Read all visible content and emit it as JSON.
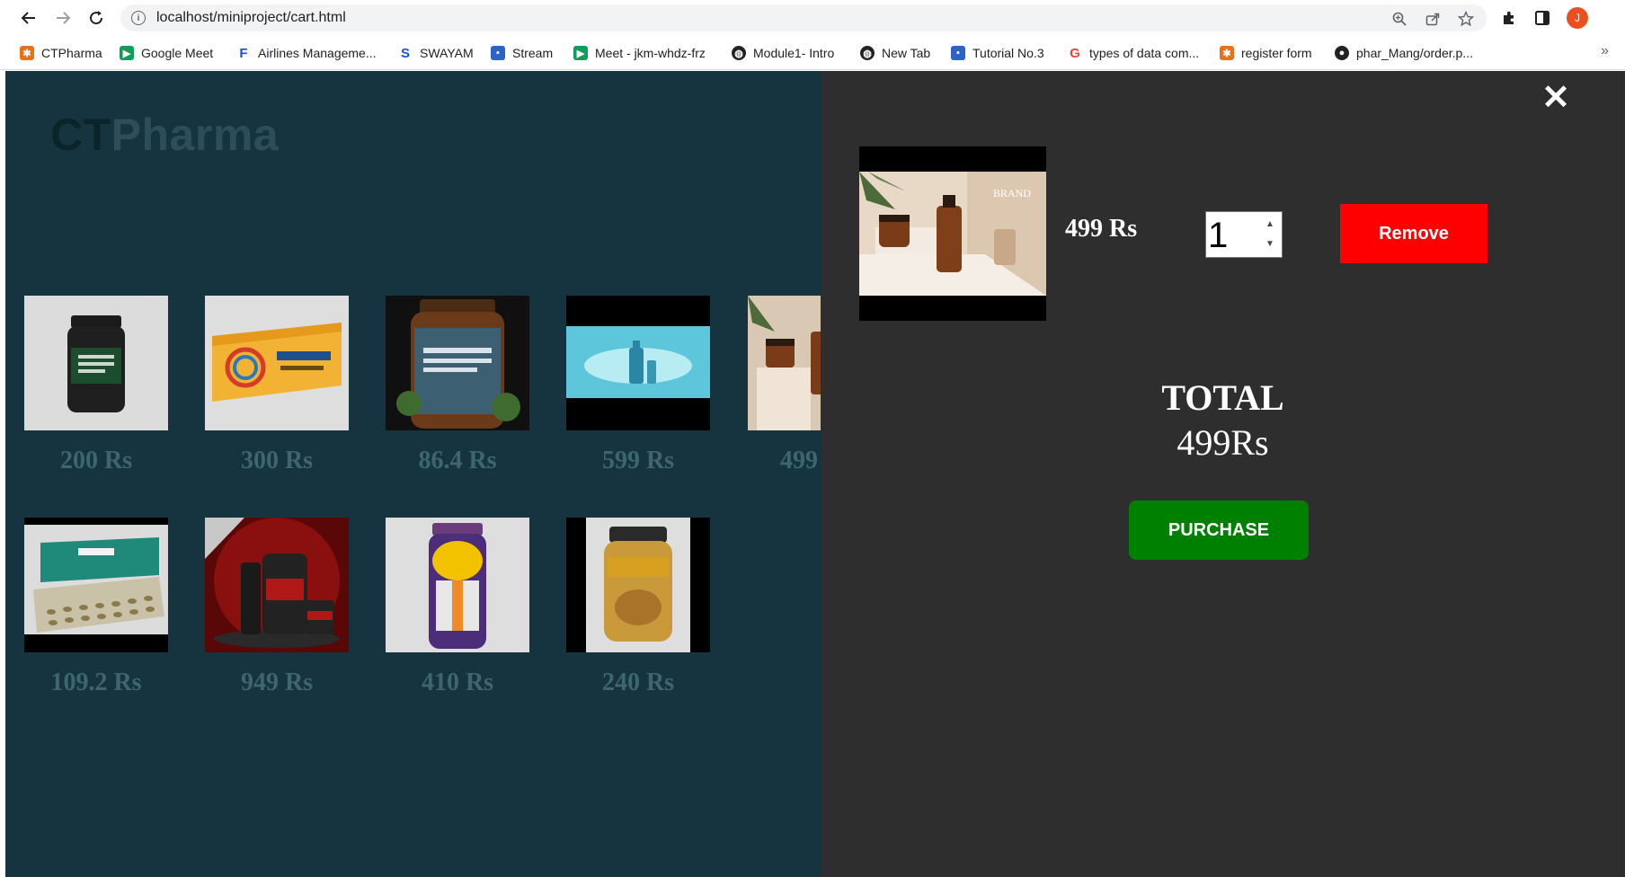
{
  "browser": {
    "url": "localhost/miniproject/cart.html",
    "avatar_letter": "J",
    "bookmarks": [
      {
        "label": "CTPharma",
        "icon": "ctpharma-icon",
        "color": "#e8711a"
      },
      {
        "label": "Google Meet",
        "icon": "google-meet-icon",
        "color": "#0f9d58"
      },
      {
        "label": "Airlines Manageme...",
        "icon": "airlines-icon",
        "color": "#1a4fd6"
      },
      {
        "label": "SWAYAM",
        "icon": "swayam-icon",
        "color": "#1a4fd6"
      },
      {
        "label": "Stream",
        "icon": "stream-icon",
        "color": "#2b64c8"
      },
      {
        "label": "Meet - jkm-whdz-frz",
        "icon": "google-meet-icon",
        "color": "#0f9d58"
      },
      {
        "label": "Module1- Intro",
        "icon": "globe-icon",
        "color": "#222222"
      },
      {
        "label": "New Tab",
        "icon": "globe-icon",
        "color": "#222222"
      },
      {
        "label": "Tutorial No.3",
        "icon": "classroom-icon",
        "color": "#2b64c8"
      },
      {
        "label": "types of data com...",
        "icon": "google-icon",
        "color": "#ea4335"
      },
      {
        "label": "register form",
        "icon": "register-icon",
        "color": "#e8711a"
      },
      {
        "label": "phar_Mang/order.p...",
        "icon": "github-icon",
        "color": "#222222"
      }
    ],
    "more_label": "»"
  },
  "store": {
    "brand_part1": "CT",
    "brand_part2": "Pharma",
    "products": [
      {
        "price": "200 Rs",
        "image": "calcium-magnesium-zinc-bottle"
      },
      {
        "price": "300 Rs",
        "image": "diabexy-basics-box"
      },
      {
        "price": "86.4 Rs",
        "image": "multivitamin-probiotics-bottle"
      },
      {
        "price": "599 Rs",
        "image": "serum-bottle-splash"
      },
      {
        "price": "499",
        "image": "brand-cosmetics-jar"
      },
      {
        "price": "109.2 Rs",
        "image": "himplasia-tablets"
      },
      {
        "price": "949 Rs",
        "image": "protein-power-tubs"
      },
      {
        "price": "410 Rs",
        "image": "bournvita-jar"
      },
      {
        "price": "240 Rs",
        "image": "peanut-butter-jar"
      }
    ]
  },
  "cart": {
    "close_icon": "close-icon",
    "item": {
      "price": "499 Rs",
      "quantity": "1",
      "image": "brand-cosmetics-jar",
      "image_text": "BRAND"
    },
    "remove_label": "Remove",
    "total_label": "TOTAL",
    "total_value": "499Rs",
    "purchase_label": "PURCHASE"
  },
  "colors": {
    "page_bg": "#16343f",
    "cart_bg": "#2e2e2e",
    "remove": "#ff0000",
    "purchase": "#008000"
  }
}
